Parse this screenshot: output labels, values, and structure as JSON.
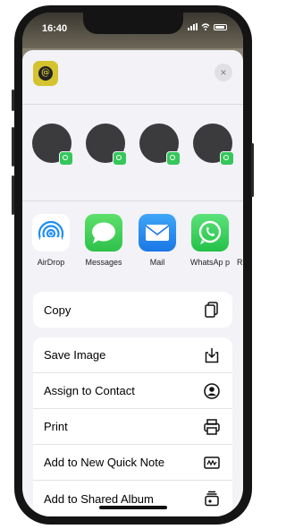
{
  "status_bar": {
    "time": "16:40"
  },
  "share_sheet": {
    "close_label": "×",
    "people": [
      {
        "badge": "whatsapp"
      },
      {
        "badge": "whatsapp"
      },
      {
        "badge": "whatsapp"
      },
      {
        "badge": "whatsapp"
      }
    ],
    "apps": [
      {
        "label": "AirDrop",
        "icon": "airdrop-icon"
      },
      {
        "label": "Messages",
        "icon": "messages-icon"
      },
      {
        "label": "Mail",
        "icon": "mail-icon"
      },
      {
        "label": "WhatsAp p",
        "icon": "whatsapp-icon"
      },
      {
        "label": "Re",
        "icon": "reminders-icon"
      }
    ],
    "actions_group_1": [
      {
        "label": "Copy",
        "icon": "copy-icon"
      }
    ],
    "actions_group_2": [
      {
        "label": "Save Image",
        "icon": "save-image-icon"
      },
      {
        "label": "Assign to Contact",
        "icon": "contact-icon"
      },
      {
        "label": "Print",
        "icon": "print-icon"
      },
      {
        "label": "Add to New Quick Note",
        "icon": "quick-note-icon"
      },
      {
        "label": "Add to Shared Album",
        "icon": "shared-album-icon"
      }
    ]
  },
  "colors": {
    "sheet_bg": "#f2f2f7",
    "whatsapp_green": "#35c75a",
    "mail_blue": "#1f8ef1",
    "app_thumb_yellow": "#d4c32f"
  }
}
